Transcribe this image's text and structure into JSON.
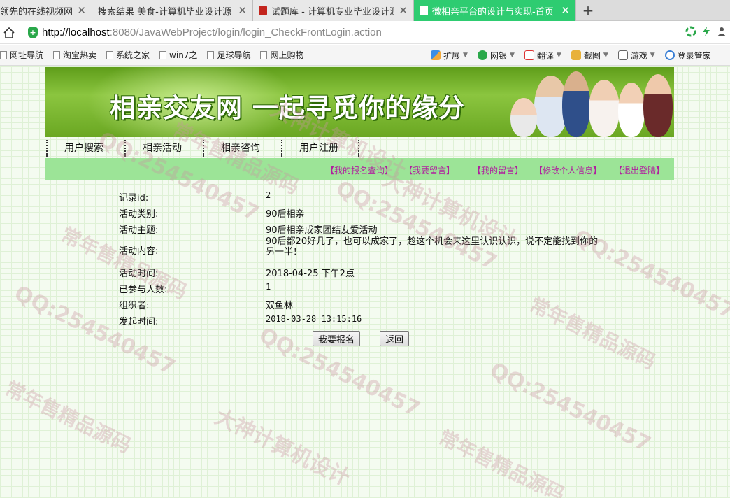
{
  "browser": {
    "tabs": [
      {
        "title": "领先的在线视频网站"
      },
      {
        "title": "搜索结果 美食-计算机毕业设计源"
      },
      {
        "title": "试题库 - 计算机专业毕业设计源码"
      },
      {
        "title": "微相亲平台的设计与实现-首页"
      }
    ],
    "url_host": "http://localhost",
    "url_path": ":8080/JavaWebProject/login/login_CheckFrontLogin.action",
    "bookmarks": [
      "网址导航",
      "淘宝热卖",
      "系统之家",
      "win7之",
      "足球导航",
      "网上购物"
    ],
    "toolbar": [
      "扩展",
      "网银",
      "翻译",
      "截图",
      "游戏",
      "登录管家"
    ]
  },
  "site": {
    "banner_title": "相亲交友网 一起寻觅你的缘分",
    "nav": [
      "用户搜索",
      "相亲活动",
      "相亲咨询",
      "用户注册"
    ],
    "subnav": [
      "【我的报名查询】",
      "【我要留言】",
      "【我的留言】",
      "【修改个人信息】",
      "【退出登陆】"
    ]
  },
  "detail": {
    "id_label": "记录id:",
    "id_value": "2",
    "type_label": "活动类别:",
    "type_value": "90后相亲",
    "theme_label": "活动主题:",
    "theme_value": "90后相亲成家团结友爱活动",
    "content_label": "活动内容:",
    "content_value": "90后都20好几了，也可以成家了，趁这个机会来这里认识认识，说不定能找到你的另一半！",
    "time_label": "活动时间:",
    "time_value": "2018-04-25 下午2点",
    "count_label": "已参与人数:",
    "count_value": "1",
    "organizer_label": "组织者:",
    "organizer_value": "双鱼林",
    "publish_label": "发起时间:",
    "publish_value": "2018-03-28 13:15:16"
  },
  "buttons": {
    "signup": "我要报名",
    "back": "返回"
  },
  "watermarks": [
    "QQ:254540457",
    "大神计算机设计",
    "常年售精品源码"
  ]
}
